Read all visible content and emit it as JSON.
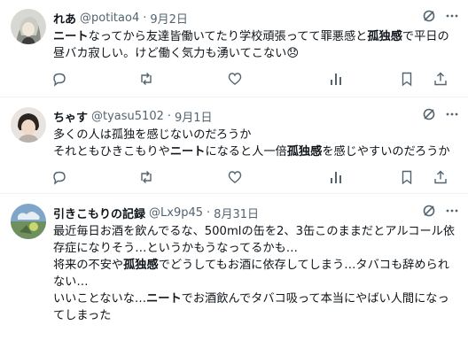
{
  "tweets": [
    {
      "name": "れあ",
      "handle": "@potitao4",
      "date": "9月2日",
      "lines": [
        [
          {
            "t": "ニート",
            "b": true
          },
          {
            "t": "なってから友達皆働いてたり学校頑張ってて罪悪感と",
            "b": false
          },
          {
            "t": "孤独感",
            "b": true
          },
          {
            "t": "で平日の",
            "b": false
          }
        ],
        [
          {
            "t": "昼バカ寂しい。けど働く気力も湧いてこない😞",
            "b": false
          }
        ]
      ]
    },
    {
      "name": "ちゃす",
      "handle": "@tyasu5102",
      "date": "9月1日",
      "lines": [
        [
          {
            "t": "多くの人は孤独を感じないのだろうか",
            "b": false
          }
        ],
        [
          {
            "t": "それともひきこもりや",
            "b": false
          },
          {
            "t": "ニート",
            "b": true
          },
          {
            "t": "になると人一倍",
            "b": false
          },
          {
            "t": "孤独感",
            "b": true
          },
          {
            "t": "を感じやすいのだろうか",
            "b": false
          }
        ]
      ]
    },
    {
      "name": "引きこもりの記録",
      "handle": "@Lx9p45",
      "date": "8月31日",
      "lines": [
        [
          {
            "t": "最近毎日お酒を飲んでるな、500mlの缶を2、3缶このままだとアルコール依",
            "b": false
          }
        ],
        [
          {
            "t": "存症になりそう…というかもうなってるかも…",
            "b": false
          }
        ],
        [
          {
            "t": "将来の不安や",
            "b": false
          },
          {
            "t": "孤独感",
            "b": true
          },
          {
            "t": "でどうしてもお酒に依存してしまう…タバコも辞められ",
            "b": false
          }
        ],
        [
          {
            "t": "ない…",
            "b": false
          }
        ],
        [
          {
            "t": "いいことないな…",
            "b": false
          },
          {
            "t": "ニート",
            "b": true
          },
          {
            "t": "でお酒飲んでタバコ吸って本当にやばい人間になっ",
            "b": false
          }
        ],
        [
          {
            "t": "てしまった",
            "b": false
          }
        ]
      ]
    }
  ],
  "icons": {
    "header": [
      "grok-icon",
      "more-icon"
    ],
    "actions": [
      "reply-icon",
      "retweet-icon",
      "like-icon",
      "views-icon",
      "bookmark-icon",
      "share-icon"
    ]
  },
  "colors": {
    "text": "#0f1419",
    "secondary": "#536471",
    "divider": "#eff3f4"
  }
}
